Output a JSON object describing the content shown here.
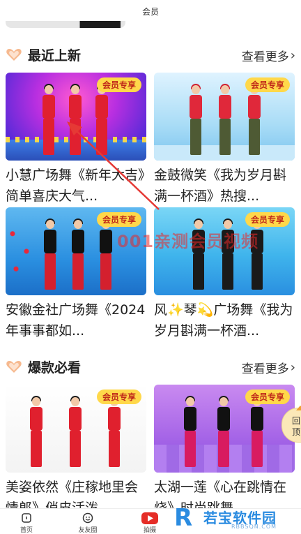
{
  "header": {
    "title": "会员"
  },
  "sections": [
    {
      "title": "最近上新",
      "more": "查看更多",
      "cards": [
        {
          "badge": "会员专享",
          "title": "小慧广场舞《新年大吉》简单喜庆大气..."
        },
        {
          "badge": "会员专享",
          "title": "金鼓微笑《我为岁月斟满一杯酒》热搜..."
        },
        {
          "badge": "会员专享",
          "title": "安徽金社广场舞《2024年事事都如..."
        },
        {
          "badge": "会员专享",
          "title": "风✨琴💫广场舞《我为岁月斟满一杯酒..."
        }
      ]
    },
    {
      "title": "爆款必看",
      "more": "查看更多",
      "cards": [
        {
          "badge": "会员专享",
          "title": "美姿依然《庄稼地里会情郎》俏皮活泼..."
        },
        {
          "badge": "会员专享",
          "title": "太湖一莲《心在跳情在烧》时尚跳舞..."
        }
      ]
    }
  ],
  "watermark": "001亲测会员视频",
  "bottom_nav": [
    {
      "label": "首页",
      "icon": "home-icon"
    },
    {
      "label": "友友圈",
      "icon": "smile-icon"
    },
    {
      "label": "拍摄",
      "icon": "play-icon"
    }
  ],
  "float_button": {
    "label_top": "回",
    "label_bottom": "顶"
  },
  "logo": {
    "letter": "R",
    "name": "若宝软件园",
    "url": "RBBSQN.COM"
  },
  "colors": {
    "badge_bg": "#ffd84a",
    "badge_text": "#c02a1a",
    "arrow": "#e53935",
    "brand_blue": "#2a8be0"
  }
}
